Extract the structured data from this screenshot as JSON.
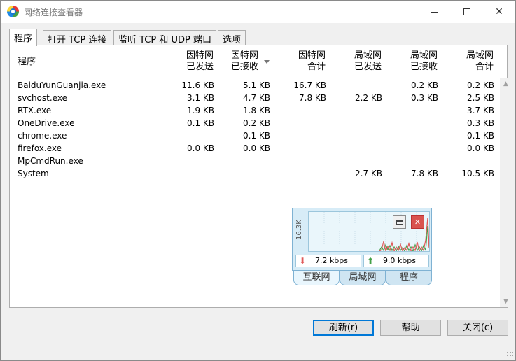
{
  "window": {
    "title": "网络连接查看器",
    "icon": "network-app-icon"
  },
  "tabs": [
    {
      "label": "程序",
      "active": true
    },
    {
      "label": "打开 TCP 连接",
      "active": false
    },
    {
      "label": "监听 TCP 和 UDP 端口",
      "active": false
    },
    {
      "label": "选项",
      "active": false
    }
  ],
  "table": {
    "headers": {
      "program": "程序",
      "inet_sent_1": "因特网",
      "inet_sent_2": "已发送",
      "inet_recv_1": "因特网",
      "inet_recv_2": "已接收",
      "inet_total_1": "因特网",
      "inet_total_2": "合计",
      "lan_sent_1": "局域网",
      "lan_sent_2": "已发送",
      "lan_recv_1": "局域网",
      "lan_recv_2": "已接收",
      "lan_total_1": "局域网",
      "lan_total_2": "合计"
    },
    "sort_column": "inet_recv",
    "rows": [
      {
        "name": "BaiduYunGuanjia.exe",
        "inet_sent": "11.6 KB",
        "inet_recv": "5.1 KB",
        "inet_total": "16.7 KB",
        "lan_sent": "",
        "lan_recv": "0.2 KB",
        "lan_total": "0.2 KB"
      },
      {
        "name": "svchost.exe",
        "inet_sent": "3.1 KB",
        "inet_recv": "4.7 KB",
        "inet_total": "7.8 KB",
        "lan_sent": "2.2 KB",
        "lan_recv": "0.3 KB",
        "lan_total": "2.5 KB"
      },
      {
        "name": "RTX.exe",
        "inet_sent": "1.9 KB",
        "inet_recv": "1.8 KB",
        "inet_total": "",
        "lan_sent": "",
        "lan_recv": "",
        "lan_total": "3.7 KB"
      },
      {
        "name": "OneDrive.exe",
        "inet_sent": "0.1 KB",
        "inet_recv": "0.2 KB",
        "inet_total": "",
        "lan_sent": "",
        "lan_recv": "",
        "lan_total": "0.3 KB"
      },
      {
        "name": "chrome.exe",
        "inet_sent": "",
        "inet_recv": "0.1 KB",
        "inet_total": "",
        "lan_sent": "",
        "lan_recv": "",
        "lan_total": "0.1 KB"
      },
      {
        "name": "firefox.exe",
        "inet_sent": "0.0 KB",
        "inet_recv": "0.0 KB",
        "inet_total": "",
        "lan_sent": "",
        "lan_recv": "",
        "lan_total": "0.0 KB"
      },
      {
        "name": "MpCmdRun.exe",
        "inet_sent": "",
        "inet_recv": "",
        "inet_total": "",
        "lan_sent": "",
        "lan_recv": "",
        "lan_total": ""
      },
      {
        "name": "System",
        "inet_sent": "",
        "inet_recv": "",
        "inet_total": "",
        "lan_sent": "2.7 KB",
        "lan_recv": "7.8 KB",
        "lan_total": "10.5 KB"
      }
    ]
  },
  "mini_monitor": {
    "scale_label": "16.3K",
    "download_rate": "7.2 kbps",
    "upload_rate": "9.0 kbps",
    "tabs": [
      "互联网",
      "局域网",
      "程序"
    ],
    "colors": {
      "download": "#e05a5a",
      "upload": "#43a047"
    }
  },
  "buttons": {
    "refresh": "刷新(r)",
    "help": "帮助",
    "close": "关闭(c)"
  }
}
